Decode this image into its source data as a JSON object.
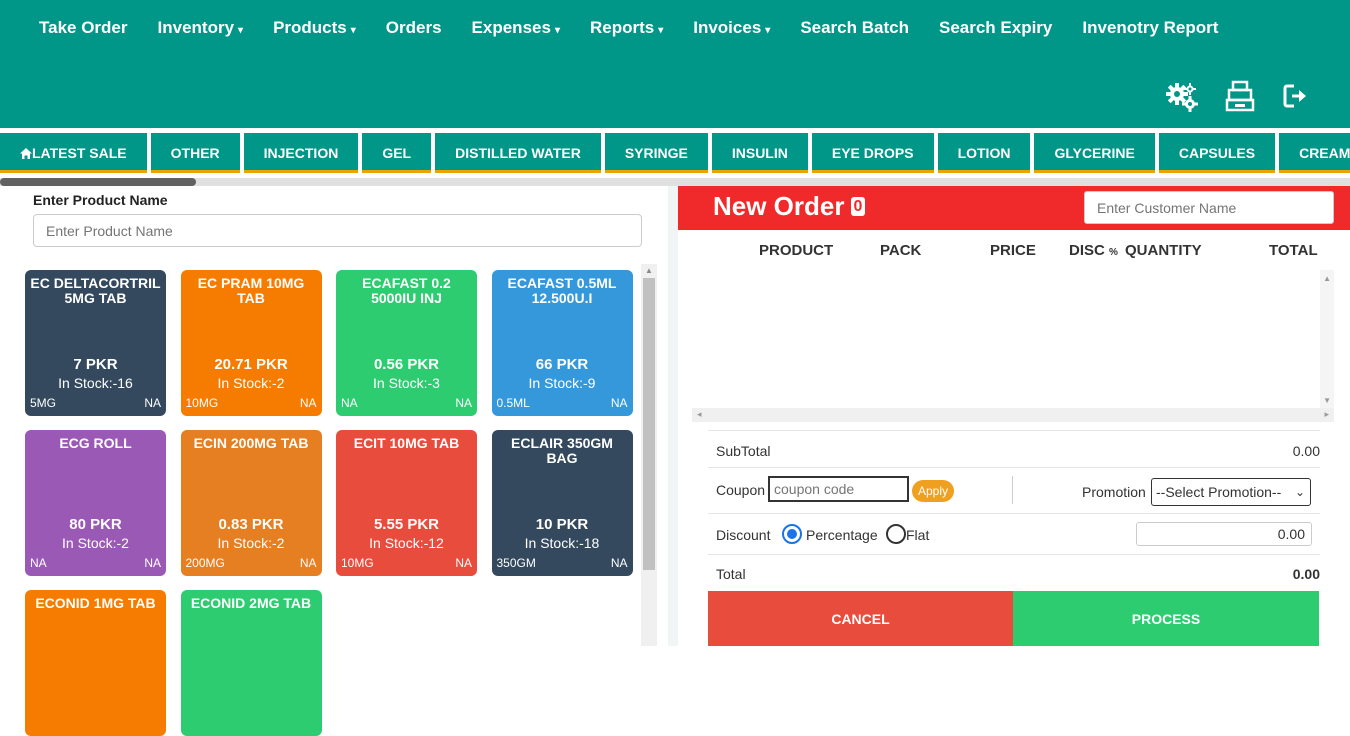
{
  "nav": {
    "items": [
      {
        "label": "Take Order",
        "dropdown": false
      },
      {
        "label": "Inventory",
        "dropdown": true
      },
      {
        "label": "Products",
        "dropdown": true
      },
      {
        "label": "Orders",
        "dropdown": false
      },
      {
        "label": "Expenses",
        "dropdown": true
      },
      {
        "label": "Reports",
        "dropdown": true
      },
      {
        "label": "Invoices",
        "dropdown": true
      },
      {
        "label": "Search Batch",
        "dropdown": false
      },
      {
        "label": "Search Expiry",
        "dropdown": false
      },
      {
        "label": "Invenotry Report",
        "dropdown": false
      }
    ],
    "caret": "▾"
  },
  "top_icons": [
    "gears-icon",
    "cash-register-icon",
    "logout-icon"
  ],
  "categories": [
    "LATEST SALE",
    "OTHER",
    "INJECTION",
    "GEL",
    "DISTILLED WATER",
    "SYRINGE",
    "INSULIN",
    "EYE DROPS",
    "LOTION",
    "GLYCERINE",
    "CAPSULES",
    "CREAM"
  ],
  "product_search": {
    "label": "Enter Product Name",
    "placeholder": "Enter Product Name"
  },
  "products": [
    {
      "name": "EC DELTACORTRIL 5MG TAB",
      "price": "7 PKR",
      "stock": "In Stock:-16",
      "unit": "5MG",
      "tag": "NA",
      "color": "#34495e"
    },
    {
      "name": "EC PRAM 10MG TAB",
      "price": "20.71 PKR",
      "stock": "In Stock:-2",
      "unit": "10MG",
      "tag": "NA",
      "color": "#f57c00"
    },
    {
      "name": "ECAFAST 0.2 5000IU INJ",
      "price": "0.56 PKR",
      "stock": "In Stock:-3",
      "unit": "NA",
      "tag": "NA",
      "color": "#2ecc71"
    },
    {
      "name": "ECAFAST 0.5ML 12.500U.I",
      "price": "66 PKR",
      "stock": "In Stock:-9",
      "unit": "0.5ML",
      "tag": "NA",
      "color": "#3498db"
    },
    {
      "name": "ECG ROLL",
      "price": "80 PKR",
      "stock": "In Stock:-2",
      "unit": "NA",
      "tag": "NA",
      "color": "#9b59b6"
    },
    {
      "name": "ECIN 200MG TAB",
      "price": "0.83 PKR",
      "stock": "In Stock:-2",
      "unit": "200MG",
      "tag": "NA",
      "color": "#e67e22"
    },
    {
      "name": "ECIT 10MG TAB",
      "price": "5.55 PKR",
      "stock": "In Stock:-12",
      "unit": "10MG",
      "tag": "NA",
      "color": "#e74c3c"
    },
    {
      "name": "ECLAIR 350GM BAG",
      "price": "10 PKR",
      "stock": "In Stock:-18",
      "unit": "350GM",
      "tag": "NA",
      "color": "#34495e"
    },
    {
      "name": "ECONID 1MG TAB",
      "price": "",
      "stock": "",
      "unit": "",
      "tag": "",
      "color": "#f57c00"
    },
    {
      "name": "ECONID 2MG TAB",
      "price": "",
      "stock": "",
      "unit": "",
      "tag": "",
      "color": "#2ecc71"
    }
  ],
  "order": {
    "title": "New Order",
    "count": "0",
    "customer_placeholder": "Enter Customer Name",
    "columns": {
      "product": "PRODUCT",
      "pack": "PACK",
      "price": "PRICE",
      "disc": "DISC",
      "disc_unit": "%",
      "quantity": "QUANTITY",
      "total": "TOTAL"
    },
    "subtotal_label": "SubTotal",
    "subtotal_value": "0.00",
    "coupon_label": "Coupon",
    "coupon_placeholder": "coupon code",
    "apply_label": "Apply",
    "promotion_label": "Promotion",
    "promotion_selected": "--Select Promotion--",
    "discount_label": "Discount",
    "discount_percentage_label": "Percentage",
    "discount_flat_label": "Flat",
    "discount_value": "0.00",
    "total_label": "Total",
    "total_value": "0.00",
    "cancel_label": "CANCEL",
    "process_label": "PROCESS"
  }
}
